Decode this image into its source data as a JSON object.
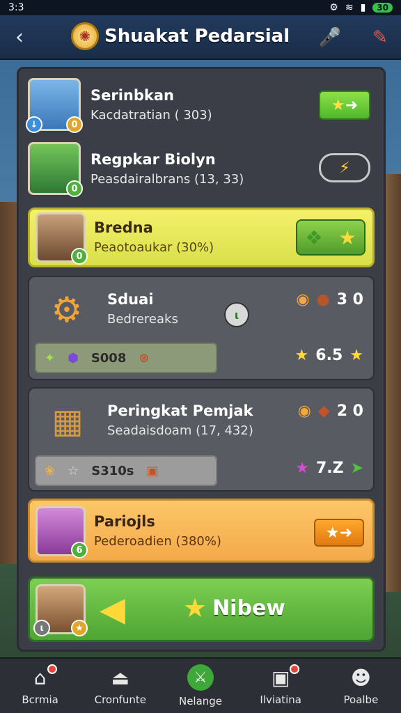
{
  "status": {
    "time": "3:3",
    "battery": "30"
  },
  "header": {
    "title": "Shuakat Pedarsial"
  },
  "rows": [
    {
      "name": "Serinbkan",
      "sub": "Kacdatratian ( 303)",
      "badge": "0"
    },
    {
      "name": "Regpkar Biolyn",
      "sub": "Peasdairalbrans (13, 33)",
      "badge": "0"
    }
  ],
  "highlight": {
    "name": "Bredna",
    "sub": "Peaotoaukar (30%)",
    "badge": "0"
  },
  "cards": [
    {
      "name": "Sduai",
      "sub": "Bedrereaks",
      "score": "3 0",
      "bar_value": "S008",
      "rating": "6.5"
    },
    {
      "name": "Peringkat Pemjak",
      "sub": "Seadaisdoam (17, 432)",
      "score": "2 0",
      "bar_value": "S310s",
      "rating": "7.Z"
    }
  ],
  "orange": {
    "name": "Pariojls",
    "sub": "Pederoadien (380%)",
    "badge": "6"
  },
  "green": {
    "label": "Nibew"
  },
  "nav": [
    {
      "label": "Bcrmia",
      "icon": "home-icon"
    },
    {
      "label": "Cronfunte",
      "icon": "anvil-icon"
    },
    {
      "label": "Nelange",
      "icon": "sword-icon"
    },
    {
      "label": "Ilviatina",
      "icon": "camera-icon"
    },
    {
      "label": "Poalbe",
      "icon": "profile-icon"
    }
  ],
  "colors": {
    "accent_yellow": "#f5f06a",
    "accent_green": "#7ccf52",
    "accent_orange": "#fcc768",
    "panel": "#3b3e46"
  }
}
